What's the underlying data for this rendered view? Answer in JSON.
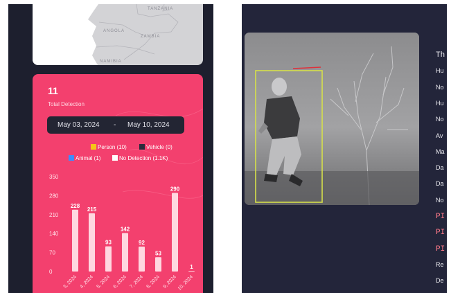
{
  "map": {
    "labels": [
      "TANZANIA",
      "ANGOLA",
      "ZAMBIA",
      "NAMIBIA"
    ]
  },
  "summary": {
    "total_count": "11",
    "total_label": "Total Detection",
    "date_start": "May 03, 2024",
    "date_separator": "-",
    "date_end": "May 10, 2024"
  },
  "legend": [
    {
      "label": "Person (10)",
      "color": "#f5c518"
    },
    {
      "label": "Vehicle (0)",
      "color": "#2b2b3b"
    },
    {
      "label": "Animal (1)",
      "color": "#3d8bfd"
    },
    {
      "label": "No Detection (1.1K)",
      "color": "#ffffff"
    }
  ],
  "chart_data": {
    "type": "bar",
    "categories": [
      "3, 2024",
      "4, 2024",
      "5, 2024",
      "6, 2024",
      "7, 2024",
      "8, 2024",
      "9, 2024",
      "10, 2024"
    ],
    "values": [
      228,
      215,
      93,
      142,
      92,
      53,
      290,
      1
    ],
    "ylim": [
      0,
      350
    ],
    "yticks": [
      0,
      70,
      140,
      210,
      280,
      350
    ],
    "grid": false,
    "bar_color": "#ffd7e0",
    "label_color": "#ffffff"
  },
  "details": {
    "lines": [
      "Th",
      "Hu",
      "No",
      "Hu",
      "No",
      "Av",
      "Ma",
      "Da",
      "Da",
      "No",
      "PI",
      "PI",
      "PI",
      "Re",
      "De"
    ]
  },
  "colors": {
    "card_bg": "#f3406e",
    "panel_bg": "#1d1f2e",
    "right_bg": "#23253a",
    "box_yellow": "#d6e04a",
    "box_red": "#e0303a"
  }
}
